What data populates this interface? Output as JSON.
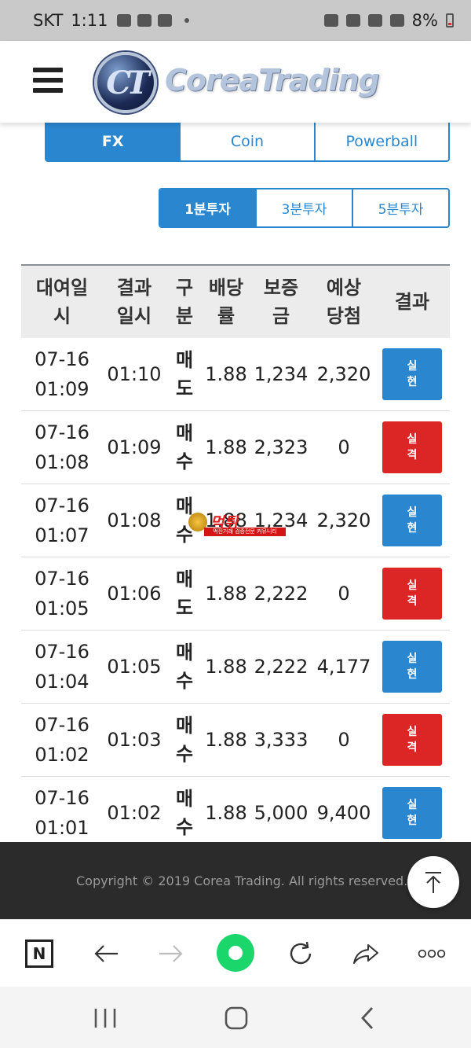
{
  "status_bar": {
    "carrier": "SKT",
    "time": "1:11",
    "battery": "8%"
  },
  "header": {
    "logo_mark": "CT",
    "logo_text": "CoreaTrading"
  },
  "category_tabs": [
    {
      "label": "FX",
      "active": true
    },
    {
      "label": "Coin",
      "active": false
    },
    {
      "label": "Powerball",
      "active": false
    }
  ],
  "interval_tabs": [
    {
      "label": "1분투자",
      "active": true
    },
    {
      "label": "3분투자",
      "active": false
    },
    {
      "label": "5분투자",
      "active": false
    }
  ],
  "table": {
    "headers": {
      "rental_time": "대여일\n시",
      "result_time": "결과\n일시",
      "side": "구\n분",
      "odds": "배당\n률",
      "deposit": "보증\n금",
      "expected": "예상\n당첨",
      "result": "결과"
    },
    "rows": [
      {
        "rental": "07-16\n01:09",
        "result_time": "01:10",
        "side": "매\n도",
        "side_type": "sell",
        "odds": "1.88",
        "deposit": "1,234",
        "expected": "2,320",
        "result": "실\n현",
        "result_type": "win"
      },
      {
        "rental": "07-16\n01:08",
        "result_time": "01:09",
        "side": "매\n수",
        "side_type": "buy",
        "odds": "1.88",
        "deposit": "2,323",
        "expected": "0",
        "result": "실\n격",
        "result_type": "lose"
      },
      {
        "rental": "07-16\n01:07",
        "result_time": "01:08",
        "side": "매\n수",
        "side_type": "buy",
        "odds": "1.88",
        "deposit": "1,234",
        "expected": "2,320",
        "result": "실\n현",
        "result_type": "win"
      },
      {
        "rental": "07-16\n01:05",
        "result_time": "01:06",
        "side": "매\n도",
        "side_type": "sell",
        "odds": "1.88",
        "deposit": "2,222",
        "expected": "0",
        "result": "실\n격",
        "result_type": "lose"
      },
      {
        "rental": "07-16\n01:04",
        "result_time": "01:05",
        "side": "매\n수",
        "side_type": "buy",
        "odds": "1.88",
        "deposit": "2,222",
        "expected": "4,177",
        "result": "실\n현",
        "result_type": "win"
      },
      {
        "rental": "07-16\n01:02",
        "result_time": "01:03",
        "side": "매\n수",
        "side_type": "buy",
        "odds": "1.88",
        "deposit": "3,333",
        "expected": "0",
        "result": "실\n격",
        "result_type": "lose"
      },
      {
        "rental": "07-16\n01:01",
        "result_time": "01:02",
        "side": "매\n수",
        "side_type": "buy",
        "odds": "1.88",
        "deposit": "5,000",
        "expected": "9,400",
        "result": "실\n현",
        "result_type": "win"
      }
    ]
  },
  "watermark": {
    "word": "먹튀",
    "sub": "먹진거래 검증전문 커뮤니티"
  },
  "footer": {
    "copyright": "Copyright © 2019 Corea Trading. All rights reserved."
  },
  "browser_bar": {
    "n_label": "N"
  },
  "colors": {
    "accent": "#2a86cf",
    "win": "#2a86cf",
    "lose": "#dc2626",
    "sell": "#1a2bd0",
    "buy": "#e01a1a",
    "footer_bg": "#2b2b2b"
  },
  "icons": [
    "menu-icon",
    "back-arrow-icon",
    "forward-arrow-icon",
    "reload-icon",
    "share-icon",
    "more-icon",
    "scroll-top-icon",
    "recent-apps-icon",
    "home-icon",
    "system-back-icon"
  ]
}
